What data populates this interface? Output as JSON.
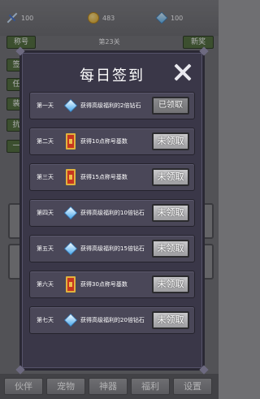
{
  "resources": {
    "swords": "100",
    "coins": "483",
    "gems": "100"
  },
  "level": "第23关",
  "background_buttons": {
    "left_top": "称号",
    "right_top": "新奖",
    "left_stack": [
      "签",
      "任",
      "装",
      "抗",
      "一"
    ]
  },
  "tabs": [
    "伙伴",
    "宠物",
    "神器",
    "福利",
    "设置"
  ],
  "dialog": {
    "title": "每日签到",
    "rows": [
      {
        "day": "第一天",
        "icon": "gem-icon",
        "desc": "获得高级福利的2倍钻石",
        "button": "已领取",
        "claimed": true
      },
      {
        "day": "第二天",
        "icon": "card-icon",
        "desc": "获得10点称号基数",
        "button": "未领取",
        "claimed": false
      },
      {
        "day": "第三天",
        "icon": "card-icon",
        "desc": "获得15点称号基数",
        "button": "未领取",
        "claimed": false
      },
      {
        "day": "第四天",
        "icon": "gem-icon",
        "desc": "获得高级福利的10倍钻石",
        "button": "未领取",
        "claimed": false
      },
      {
        "day": "第五天",
        "icon": "gem-icon",
        "desc": "获得高级福利的15倍钻石",
        "button": "未领取",
        "claimed": false
      },
      {
        "day": "第六天",
        "icon": "card-icon",
        "desc": "获得30点称号基数",
        "button": "未领取",
        "claimed": false
      },
      {
        "day": "第七天",
        "icon": "gem-icon",
        "desc": "获得高级福利的20倍钻石",
        "button": "未领取",
        "claimed": false
      }
    ]
  },
  "colors": {
    "dialog_bg": "#3a3748",
    "row_bg": "#4a4758",
    "button": "#b3b3b5"
  }
}
